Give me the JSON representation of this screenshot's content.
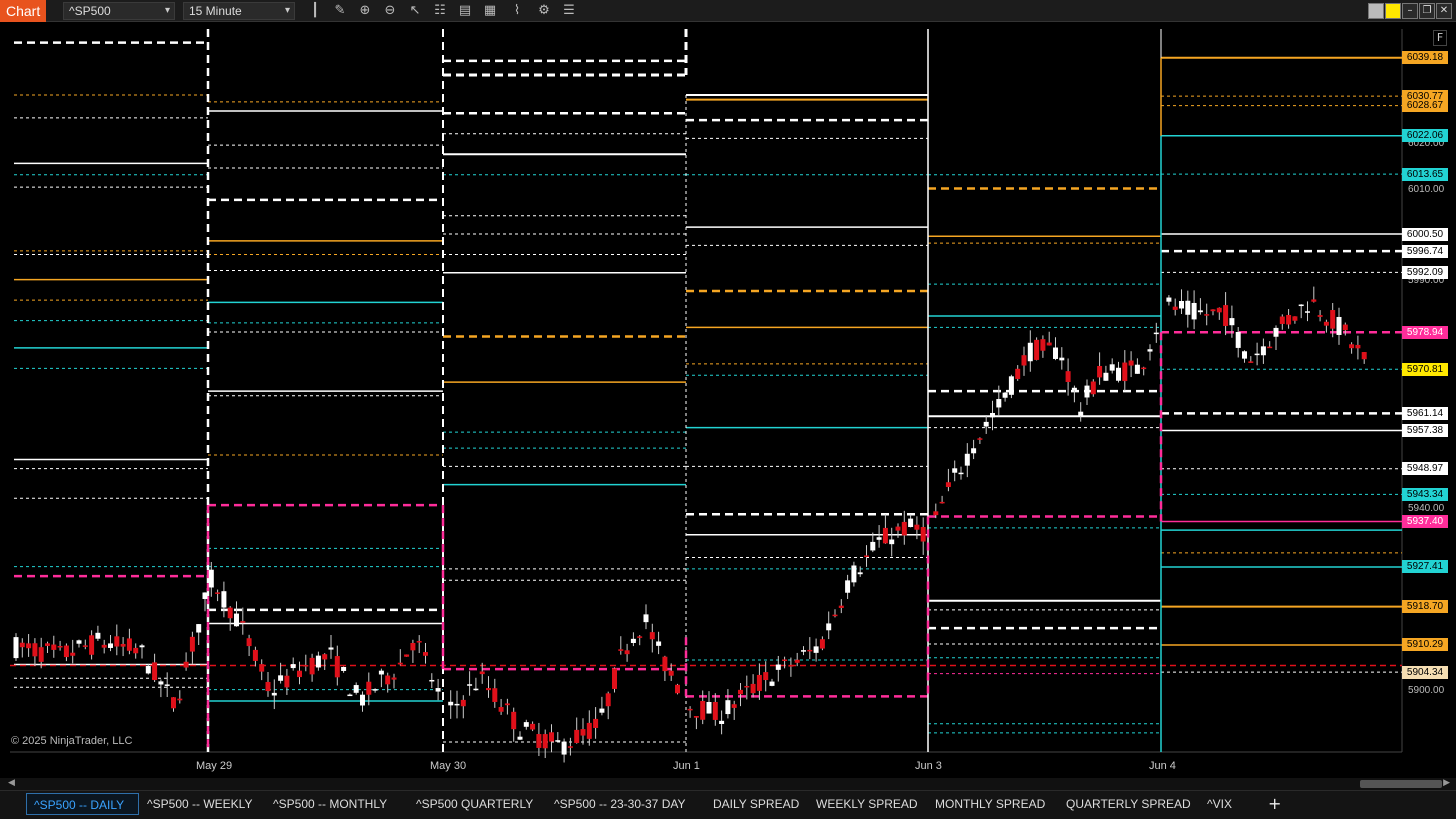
{
  "toolbar": {
    "app_tag": "Chart",
    "instrument": "^SP500",
    "interval": "15 Minute",
    "caret": "▾",
    "icons": [
      "bar-type-icon",
      "draw-icon",
      "zoom-icon",
      "zoom-out-icon",
      "pointer-icon",
      "data-box-icon",
      "template-icon",
      "strategies-icon",
      "indicators-icon",
      "properties-icon",
      "list-icon"
    ],
    "icon_glyphs": [
      "┃",
      "✎",
      "⊕",
      "⊖",
      "↖",
      "☷",
      "▤",
      "▦",
      "⌇",
      "⚙",
      "☰"
    ],
    "window_buttons": [
      "",
      "",
      "–",
      "❐",
      "✕"
    ]
  },
  "chart": {
    "f_button": "F",
    "copyright": "© 2025 NinjaTrader, LLC",
    "x_labels": [
      {
        "text": "May 29",
        "slot": 0
      },
      {
        "text": "May 30",
        "slot": 1
      },
      {
        "text": "Jun 1",
        "slot": 2
      },
      {
        "text": "Jun 3",
        "slot": 3
      },
      {
        "text": "Jun 4",
        "slot": 4
      }
    ],
    "axis_labels": [
      "6020.00",
      "6010.00",
      "5990.00",
      "5940.00",
      "5900.00"
    ],
    "price_tags": [
      {
        "text": "6039.18",
        "price": 6039.18,
        "bg": "#f5a623",
        "fg": "#000"
      },
      {
        "text": "6030.77",
        "price": 6030.77,
        "bg": "#f5a623",
        "fg": "#000"
      },
      {
        "text": "6028.67",
        "price": 6028.67,
        "bg": "#f5a623",
        "fg": "#000"
      },
      {
        "text": "6022.06",
        "price": 6022.06,
        "bg": "#22d3d3",
        "fg": "#000"
      },
      {
        "text": "6013.65",
        "price": 6013.65,
        "bg": "#22d3d3",
        "fg": "#000"
      },
      {
        "text": "6000.50",
        "price": 6000.5,
        "bg": "#ffffff",
        "fg": "#000"
      },
      {
        "text": "5996.74",
        "price": 5996.74,
        "bg": "#ffffff",
        "fg": "#000"
      },
      {
        "text": "5992.09",
        "price": 5992.09,
        "bg": "#ffffff",
        "fg": "#000"
      },
      {
        "text": "5978.94",
        "price": 5978.94,
        "bg": "#ff2d9a",
        "fg": "#fff"
      },
      {
        "text": "5970.81",
        "price": 5970.81,
        "bg": "#ffe800",
        "fg": "#000"
      },
      {
        "text": "5961.14",
        "price": 5961.14,
        "bg": "#ffffff",
        "fg": "#000"
      },
      {
        "text": "5957.38",
        "price": 5957.38,
        "bg": "#ffffff",
        "fg": "#000"
      },
      {
        "text": "5948.97",
        "price": 5948.97,
        "bg": "#ffffff",
        "fg": "#000"
      },
      {
        "text": "5943.34",
        "price": 5943.34,
        "bg": "#22d3d3",
        "fg": "#000"
      },
      {
        "text": "5937.40",
        "price": 5937.4,
        "bg": "#ff2d9a",
        "fg": "#fff"
      },
      {
        "text": "5927.41",
        "price": 5927.41,
        "bg": "#22d3d3",
        "fg": "#000"
      },
      {
        "text": "5918.70",
        "price": 5918.7,
        "bg": "#f5a623",
        "fg": "#000"
      },
      {
        "text": "5910.29",
        "price": 5910.29,
        "bg": "#f5a623",
        "fg": "#000"
      },
      {
        "text": "5904.34",
        "price": 5904.34,
        "bg": "#f5deb3",
        "fg": "#000"
      }
    ],
    "colors": {
      "orange": "#f5a623",
      "cyan": "#22d3d3",
      "white": "#ffffff",
      "magenta": "#ff2d9a",
      "red": "#e0101a",
      "up_candle": "#ffffff",
      "down_candle": "#e0101a"
    }
  },
  "tabs": [
    {
      "label": "^SP500 -- DAILY",
      "active": true
    },
    {
      "label": "^SP500 -- WEEKLY",
      "active": false
    },
    {
      "label": "^SP500 -- MONTHLY",
      "active": false
    },
    {
      "label": "^SP500 QUARTERLY",
      "active": false
    },
    {
      "label": "^SP500 -- 23-30-37 DAY",
      "active": false
    },
    {
      "label": "DAILY SPREAD",
      "active": false
    },
    {
      "label": "WEEKLY SPREAD",
      "active": false
    },
    {
      "label": "MONTHLY SPREAD",
      "active": false
    },
    {
      "label": "QUARTERLY SPREAD",
      "active": false
    },
    {
      "label": "^VIX",
      "active": false
    }
  ],
  "tab_add": "+",
  "scroll": {
    "left": "◀",
    "right": "▶"
  }
}
